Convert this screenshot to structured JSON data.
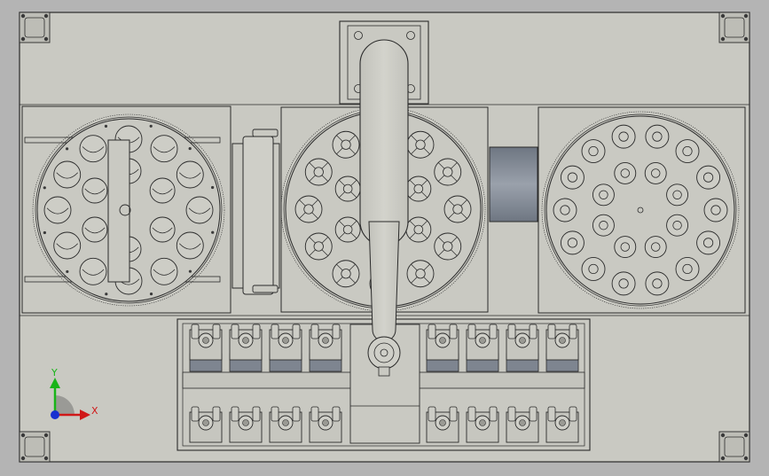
{
  "view": {
    "background": "#b4b4b4",
    "part_fill": "#c9c9c2",
    "line_color": "#2a2a2a",
    "hole_color": "#7e8590"
  },
  "triad": {
    "x_label": "X",
    "y_label": "Y",
    "x_color": "#d01818",
    "y_color": "#18b418",
    "z_color": "#1830d0"
  },
  "left_disc": {
    "pocket_count": 18,
    "pocket_style": "ball-cup"
  },
  "center_disc": {
    "pocket_count": 18,
    "pocket_style": "spoked-cup"
  },
  "right_disc": {
    "pocket_count": 22,
    "pocket_style": "ring-hole"
  },
  "gripper_rows": {
    "top_count": 8,
    "bottom_count": 8
  }
}
